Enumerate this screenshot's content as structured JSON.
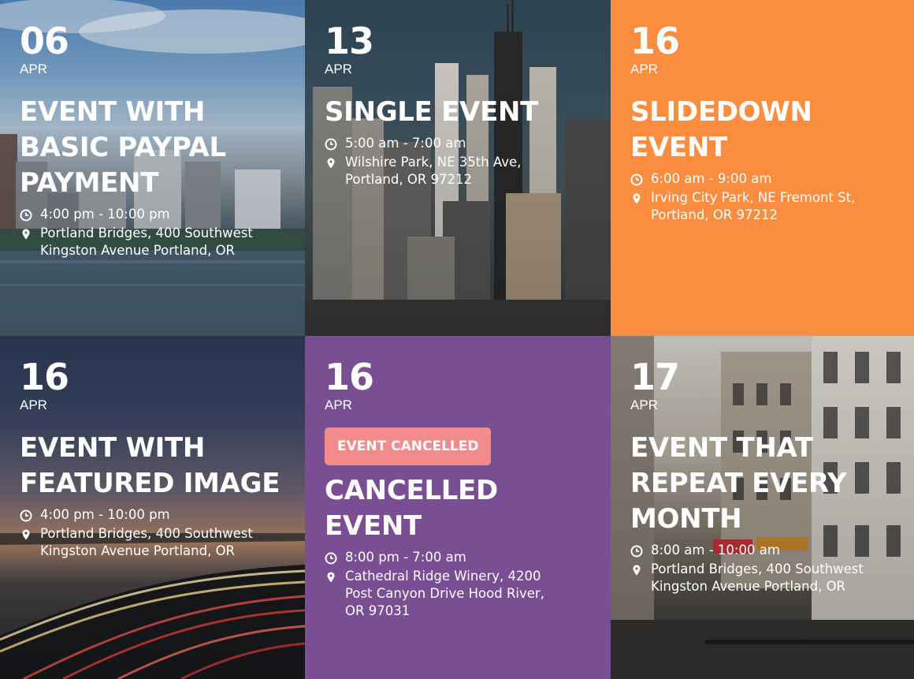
{
  "events": [
    {
      "day": "06",
      "month": "APR",
      "title_lines": [
        "EVENT WITH",
        "BASIC PAYPAL",
        "PAYMENT"
      ],
      "time": "4:00 pm - 10:00 pm",
      "location_lines": [
        "Portland Bridges, 400 Southwest",
        "Kingston Avenue Portland, OR"
      ],
      "background": "city-skyline-river-photo"
    },
    {
      "day": "13",
      "month": "APR",
      "title_lines": [
        "SINGLE EVENT"
      ],
      "time": "5:00 am - 7:00 am",
      "location_lines": [
        "Wilshire Park, NE 35th Ave,",
        "Portland, OR 97212"
      ],
      "background": "aerial-skyscrapers-photo"
    },
    {
      "day": "16",
      "month": "APR",
      "title_lines": [
        "SLIDEDOWN",
        "EVENT"
      ],
      "time": "6:00 am - 9:00 am",
      "location_lines": [
        "Irving City Park, NE Fremont St,",
        "Portland, OR 97212"
      ],
      "background_color": "#fb8d41"
    },
    {
      "day": "16",
      "month": "APR",
      "title_lines": [
        "EVENT WITH",
        "FEATURED IMAGE"
      ],
      "time": "4:00 pm - 10:00 pm",
      "location_lines": [
        "Portland Bridges, 400 Southwest",
        "Kingston Avenue Portland, OR"
      ],
      "background": "highway-light-trails-sunset-photo"
    },
    {
      "day": "16",
      "month": "APR",
      "badge": "EVENT CANCELLED",
      "title_lines": [
        "CANCELLED",
        "EVENT"
      ],
      "time": "8:00 pm - 7:00 am",
      "location_lines": [
        "Cathedral Ridge Winery, 4200",
        "Post Canyon Drive Hood River,",
        "OR 97031"
      ],
      "background_color": "#7a4e92"
    },
    {
      "day": "17",
      "month": "APR",
      "title_lines": [
        "EVENT THAT",
        "REPEAT EVERY",
        "MONTH"
      ],
      "time": "8:00 am - 10:00 am",
      "location_lines": [
        "Portland Bridges, 400 Southwest",
        "Kingston Avenue Portland, OR"
      ],
      "background": "paris-street-buildings-photo"
    }
  ],
  "icons": {
    "time": "clock-icon",
    "location": "map-pin-icon"
  },
  "colors": {
    "orange": "#fb8d41",
    "purple": "#7a4e92",
    "badge": "#f28b8b",
    "text": "#ffffff"
  }
}
